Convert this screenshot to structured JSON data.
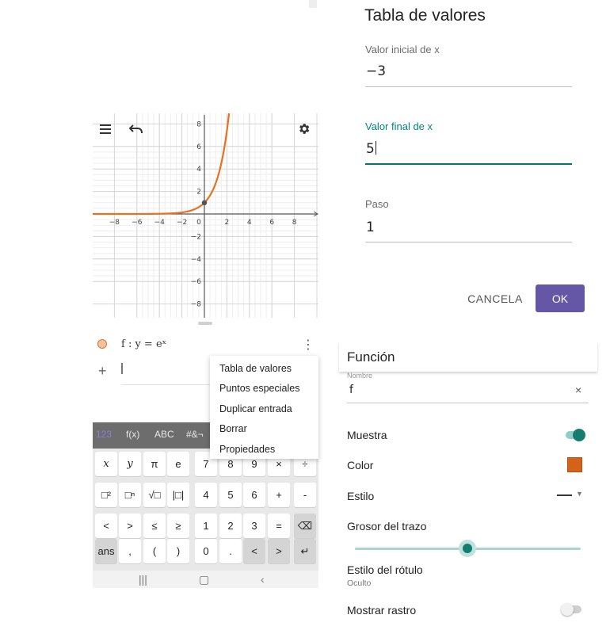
{
  "dialog": {
    "title": "Tabla de valores",
    "fields": [
      {
        "label": "Valor inicial de x",
        "value": "−3",
        "active": false
      },
      {
        "label": "Valor final de x",
        "value": "5",
        "active": true
      },
      {
        "label": "Paso",
        "value": "1",
        "active": false
      }
    ],
    "cancel_label": "CANCELA",
    "ok_label": "OK"
  },
  "graph": {
    "icons": [
      "menu-icon",
      "undo-icon",
      "gear-icon"
    ],
    "x_ticks": [
      "−8",
      "−6",
      "−4",
      "−2",
      "0",
      "2",
      "4",
      "6",
      "8"
    ],
    "y_ticks": [
      "8",
      "6",
      "4",
      "2",
      "−2",
      "−4",
      "−6",
      "−8"
    ],
    "curve_color": "#e8711f",
    "function": "exp"
  },
  "algebra": {
    "expression": "f :  y  =  eˣ",
    "kebab": "⋮",
    "plus": "+"
  },
  "context_menu": {
    "items": [
      "Tabla de valores",
      "Puntos especiales",
      "Duplicar entrada",
      "Borrar",
      "Propiedades"
    ]
  },
  "keyboard": {
    "tabs": [
      "123",
      "f(x)",
      "ABC",
      "#&¬"
    ],
    "rows": [
      [
        "x",
        "y",
        "π",
        "e",
        "7",
        "8",
        "9",
        "×",
        "÷"
      ],
      [
        "□²",
        "□ⁿ",
        "√□",
        "|□|",
        "4",
        "5",
        "6",
        "+",
        "-"
      ],
      [
        "<",
        ">",
        "≤",
        "≥",
        "1",
        "2",
        "3",
        "=",
        "⌫"
      ],
      [
        "ans",
        ",",
        "(",
        ")",
        "0",
        ".",
        "<",
        ">",
        "↵"
      ]
    ]
  },
  "navbar": {
    "icons": [
      "|||",
      "▢",
      "‹"
    ]
  },
  "props": {
    "title": "Función",
    "name_label": "Nombre",
    "name_value": "f",
    "clear": "×",
    "show_label": "Muestra",
    "color_label": "Color",
    "color_value": "#d5621b",
    "style_label": "Estilo",
    "thickness_label": "Grosor del trazo",
    "thickness_value": 0.5,
    "label_style_label": "Estilo del rótulo",
    "label_style_value": "Oculto",
    "trace_label": "Mostrar rastro",
    "show_on": true,
    "trace_on": false
  }
}
